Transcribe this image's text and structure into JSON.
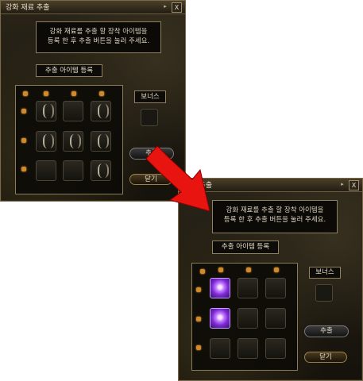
{
  "window_back": {
    "title": "강화 재료 추출",
    "close_label": "X",
    "info_lines": [
      "강화 재료를 추출 할 장착 아이템을",
      "등록 한 후 추출 버튼을 눌러 주세요."
    ],
    "register_label": "추출 아이템 등록",
    "bonus_label": "보너스",
    "extract_label": "추출",
    "close_button_label": "닫기",
    "slots": [
      "empty",
      "empty",
      "empty",
      "empty",
      "empty",
      "empty",
      "empty",
      "empty",
      "empty"
    ]
  },
  "window_front": {
    "title": "재료 추출",
    "close_label": "X",
    "info_lines": [
      "강화 재료를 추출 할 장착 아이템을",
      "등록 한 후 추출 버튼을 눌러 주세요."
    ],
    "register_label": "추출 아이템 등록",
    "bonus_label": "보너스",
    "extract_label": "추출",
    "close_button_label": "닫기",
    "slots": [
      "gem",
      "empty",
      "empty",
      "gem",
      "empty",
      "empty",
      "empty",
      "empty",
      "empty"
    ]
  },
  "arrow_color": "#e8140f",
  "accent_color": "#d08a2a"
}
